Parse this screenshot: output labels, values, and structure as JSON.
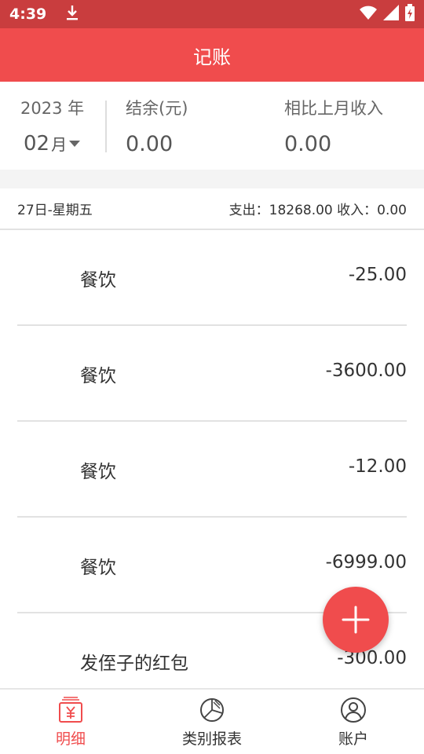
{
  "status_bar": {
    "time": "4:39"
  },
  "header": {
    "title": "记账"
  },
  "summary": {
    "year": "2023 年",
    "month_number": "02",
    "month_unit": "月",
    "balance_label": "结余(元)",
    "balance_value": "0.00",
    "compare_label": "相比上月收入",
    "compare_value": "0.00"
  },
  "day": {
    "date": "27日-星期五",
    "totals": "支出：18268.00 收入：0.00"
  },
  "records": [
    {
      "category": "餐饮",
      "amount": "-25.00"
    },
    {
      "category": "餐饮",
      "amount": "-3600.00"
    },
    {
      "category": "餐饮",
      "amount": "-12.00"
    },
    {
      "category": "餐饮",
      "amount": "-6999.00"
    },
    {
      "category": "发侄子的红包",
      "amount": "-300.00"
    }
  ],
  "bottom_nav": [
    {
      "label": "明细",
      "icon": "ledger-icon",
      "active": true
    },
    {
      "label": "类别报表",
      "icon": "pie-chart-icon",
      "active": false
    },
    {
      "label": "账户",
      "icon": "user-icon",
      "active": false
    }
  ],
  "colors": {
    "accent": "#f04c4d",
    "status_bar": "#c93d3e"
  }
}
